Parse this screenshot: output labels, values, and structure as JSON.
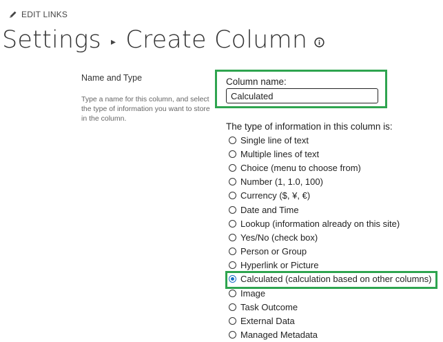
{
  "top_link": {
    "label": "EDIT LINKS",
    "icon": "pencil-icon"
  },
  "header": {
    "crumb": "Settings",
    "title": "Create Column",
    "separator_icon": "chevron-right-icon",
    "info_icon": "info-icon"
  },
  "section": {
    "title": "Name and Type",
    "description": "Type a name for this column, and select the type of information you want to store in the column."
  },
  "column_name": {
    "label": "Column name:",
    "value": "Calculated"
  },
  "type_question": "The type of information in this column is:",
  "types": [
    {
      "label": "Single line of text",
      "selected": false
    },
    {
      "label": "Multiple lines of text",
      "selected": false
    },
    {
      "label": "Choice (menu to choose from)",
      "selected": false
    },
    {
      "label": "Number (1, 1.0, 100)",
      "selected": false
    },
    {
      "label": "Currency ($, ¥, €)",
      "selected": false
    },
    {
      "label": "Date and Time",
      "selected": false
    },
    {
      "label": "Lookup (information already on this site)",
      "selected": false
    },
    {
      "label": "Yes/No (check box)",
      "selected": false
    },
    {
      "label": "Person or Group",
      "selected": false
    },
    {
      "label": "Hyperlink or Picture",
      "selected": false
    },
    {
      "label": "Calculated (calculation based on other columns)",
      "selected": true
    },
    {
      "label": "Image",
      "selected": false
    },
    {
      "label": "Task Outcome",
      "selected": false
    },
    {
      "label": "External Data",
      "selected": false
    },
    {
      "label": "Managed Metadata",
      "selected": false
    }
  ],
  "colors": {
    "highlight": "#2ea44f",
    "radio_selected": "#1a6fc4"
  }
}
